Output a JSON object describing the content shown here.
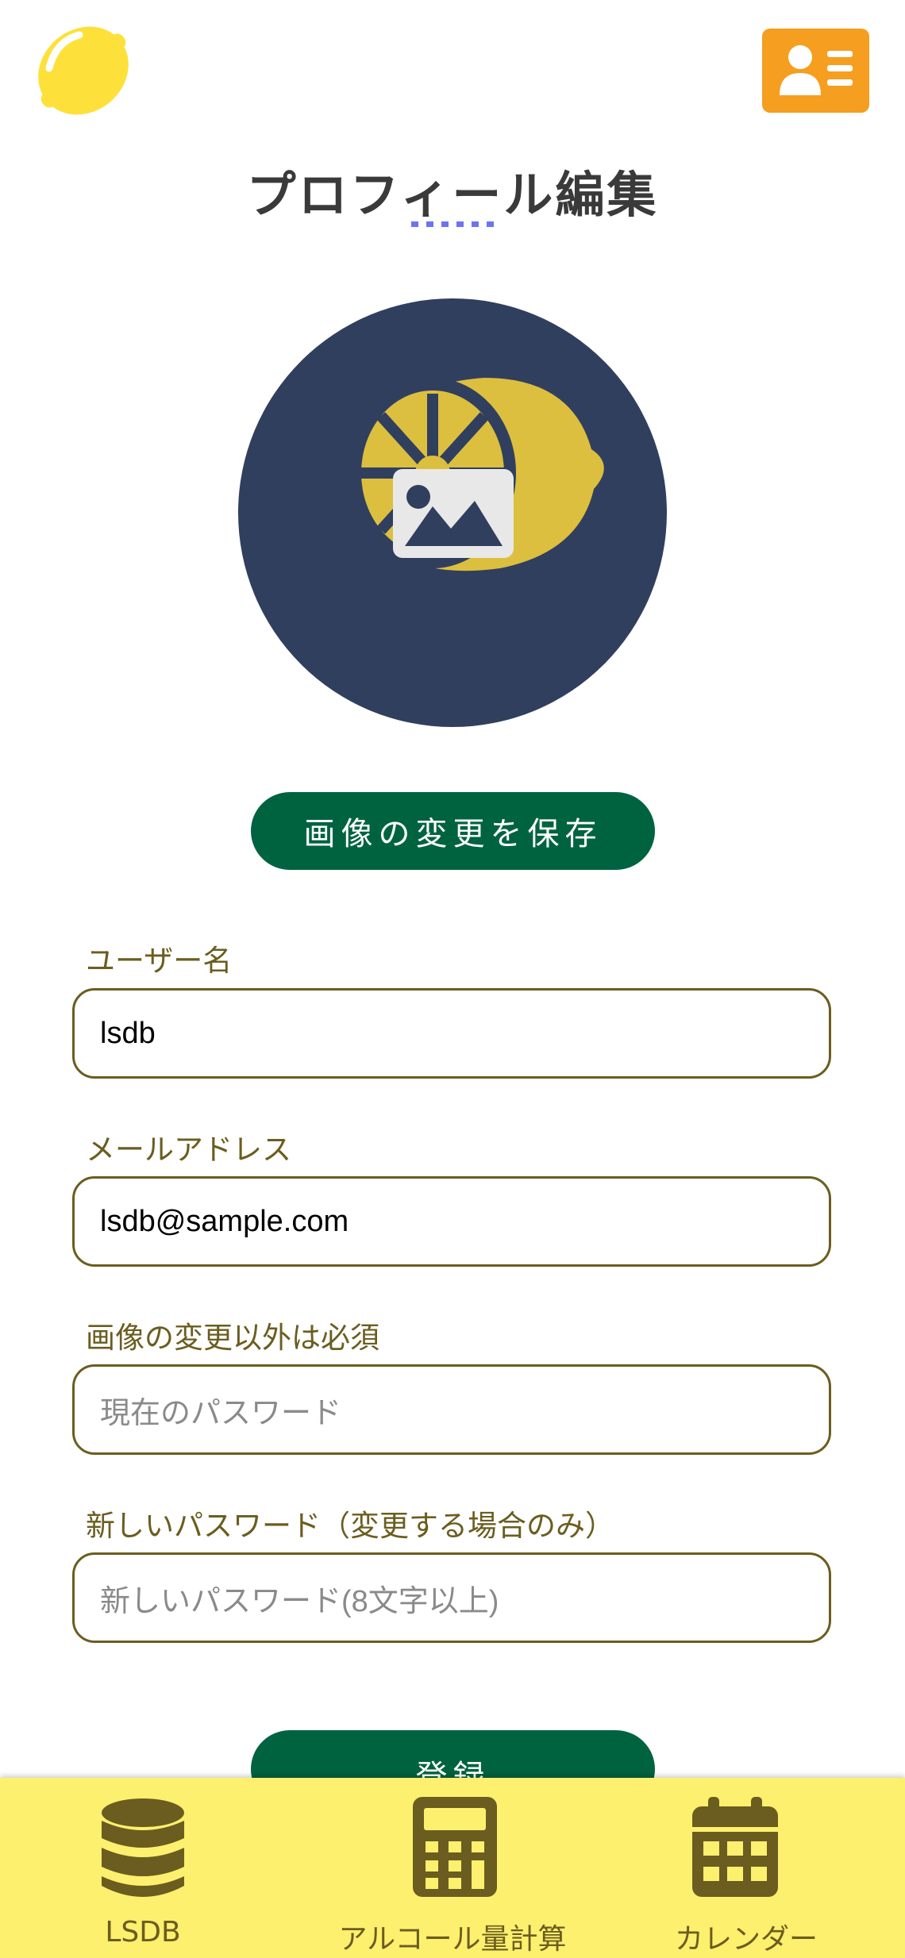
{
  "header": {
    "logo_icon": "lemon-icon",
    "menu_icon": "user-list-icon",
    "title": "プロフィール編集"
  },
  "avatar": {
    "icon": "lemon-avatar",
    "overlay_icon": "image-icon"
  },
  "save_image_button": "画像の変更を保存",
  "form": {
    "username": {
      "label": "ユーザー名",
      "value": "lsdb"
    },
    "email": {
      "label": "メールアドレス",
      "value": "lsdb@sample.com"
    },
    "current_password": {
      "label": "画像の変更以外は必須",
      "placeholder": "現在のパスワード"
    },
    "new_password": {
      "label": "新しいパスワード（変更する場合のみ）",
      "placeholder": "新しいパスワード(8文字以上)"
    }
  },
  "register_button": "登録",
  "bottom_nav": [
    {
      "label": "LSDB",
      "icon": "database-icon"
    },
    {
      "label": "アルコール量計算",
      "icon": "calculator-icon"
    },
    {
      "label": "カレンダー",
      "icon": "calendar-icon"
    }
  ],
  "colors": {
    "brand_green": "#006340",
    "menu_orange": "#f59e1f",
    "nav_yellow": "#fdf06e",
    "label_olive": "#6b5d1f",
    "avatar_navy": "#313f5e",
    "lemon_yellow": "#fde13a"
  }
}
